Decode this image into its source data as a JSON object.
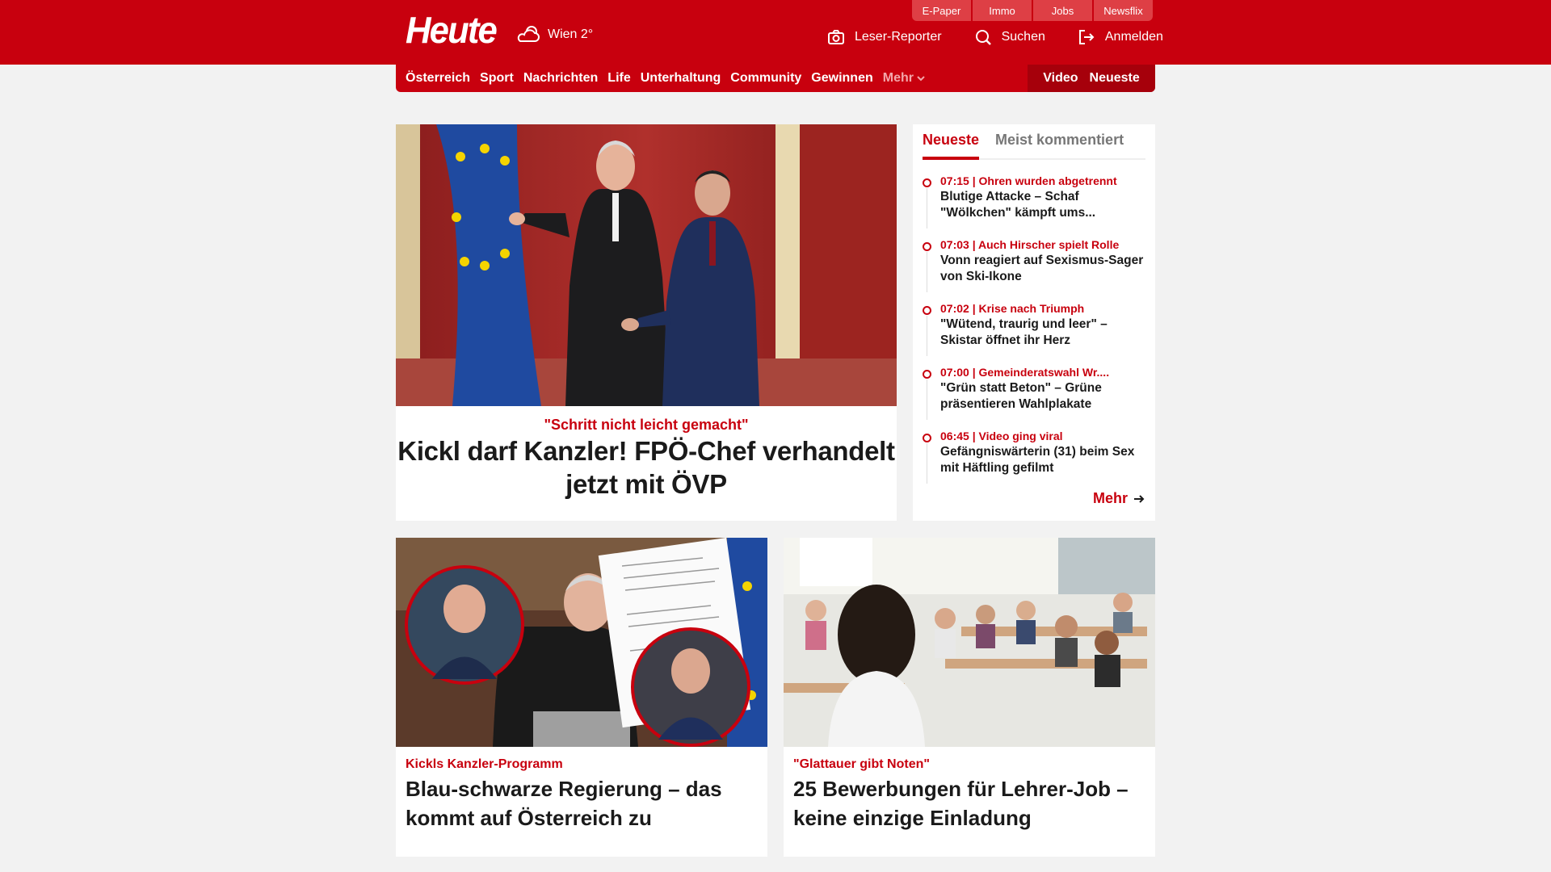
{
  "header": {
    "logo": "Heute",
    "weather": {
      "icon": "weather-cloud-sun-icon",
      "text": "Wien 2°"
    },
    "top_tabs": [
      "E-Paper",
      "Immo",
      "Jobs",
      "Newsflix"
    ],
    "actions": [
      {
        "icon": "camera-icon",
        "label": "Leser-Reporter"
      },
      {
        "icon": "search-icon",
        "label": "Suchen"
      },
      {
        "icon": "login-icon",
        "label": "Anmelden"
      }
    ]
  },
  "nav": {
    "items": [
      "Österreich",
      "Sport",
      "Nachrichten",
      "Life",
      "Unterhaltung",
      "Community",
      "Gewinnen"
    ],
    "more": "Mehr",
    "right": [
      "Video",
      "Neueste"
    ]
  },
  "hero": {
    "kicker": "\"Schritt nicht leicht gemacht\"",
    "title": "Kickl darf Kanzler! FPÖ-Chef verhandelt jetzt mit ÖVP"
  },
  "sidebar": {
    "tabs": [
      "Neueste",
      "Meist kommentiert"
    ],
    "items": [
      {
        "meta": "07:15 | Ohren wurden abgetrennt",
        "title": "Blutige Attacke – Schaf \"Wölkchen\" kämpft ums..."
      },
      {
        "meta": "07:03 | Auch Hirscher spielt Rolle",
        "title": "Vonn reagiert auf Sexismus-Sager von Ski-Ikone"
      },
      {
        "meta": "07:02 | Krise nach Triumph",
        "title": "\"Wütend, traurig und leer\" – Skistar öffnet ihr Herz"
      },
      {
        "meta": "07:00 | Gemeinderatswahl Wr....",
        "title": "\"Grün statt Beton\" – Grüne präsentieren Wahlplakate"
      },
      {
        "meta": "06:45 | Video ging viral",
        "title": "Gefängniswärterin (31) beim Sex mit Häftling gefilmt"
      }
    ],
    "more": "Mehr"
  },
  "cards": [
    {
      "kicker": "Kickls Kanzler-Programm",
      "title": "Blau-schwarze Regierung – das kommt auf Österreich zu"
    },
    {
      "kicker": "\"Glattauer gibt Noten\"",
      "title": "25 Bewerbungen für Lehrer-Job – keine einzige Einladung"
    }
  ],
  "colors": {
    "brand": "#c8000e",
    "brand_dark": "#a6000b",
    "tab": "#de3f45",
    "page_bg": "#f2f2f2"
  }
}
